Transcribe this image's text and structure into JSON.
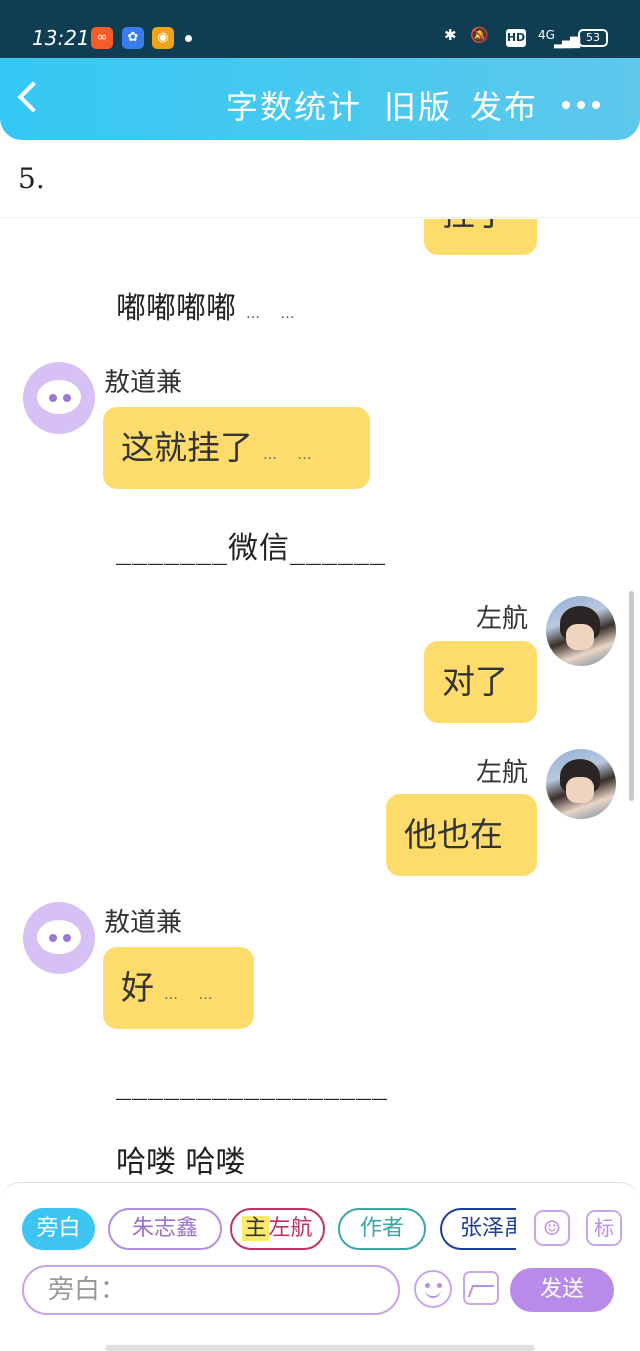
{
  "status_bar": {
    "time": "13:21",
    "network": "4G",
    "hd": "HD",
    "battery": "53"
  },
  "header": {
    "title": "字数统计",
    "old_version": "旧版",
    "publish": "发布"
  },
  "chapter": "5.",
  "messages": {
    "top_partial": "挂了",
    "narration_1": "嘟嘟嘟嘟",
    "bot_name_1": "敖道兼",
    "bot_text_1": "这就挂了",
    "narration_2": "_______微信______",
    "user_name_1": "左航",
    "user_text_1": "对了",
    "user_name_2": "左航",
    "user_text_2": "他也在",
    "bot_name_2": "敖道兼",
    "bot_text_2": "好",
    "narration_3": "_________________",
    "narration_4": "哈喽 哈喽",
    "ellipsis": "… …"
  },
  "roles": {
    "narrator": "旁白",
    "role_1": "朱志鑫",
    "role_2_tag": "主",
    "role_2": "左航",
    "role_3": "作者",
    "role_4": "张泽禹",
    "mark": "标"
  },
  "input": {
    "placeholder": "旁白："
  },
  "send_label": "发送",
  "colors": {
    "header": "#35c8f4",
    "bubble": "#fddc6c",
    "accent": "#b88bea"
  }
}
